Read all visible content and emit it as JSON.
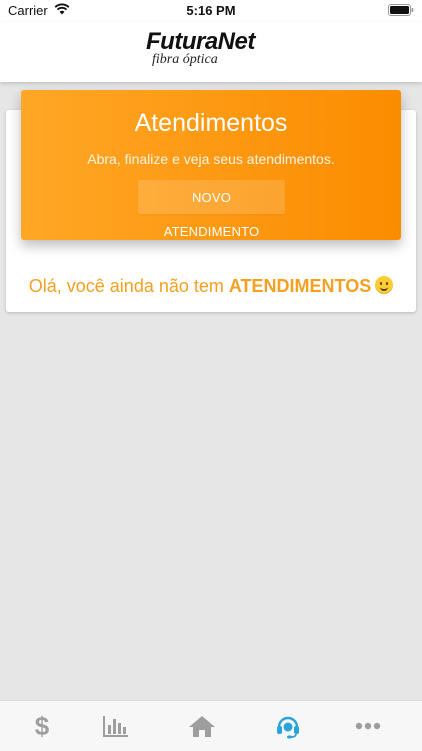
{
  "status_bar": {
    "carrier": "Carrier",
    "time": "5:16 PM"
  },
  "header": {
    "logo_main": "FuturaNet",
    "logo_sub": "fibra óptica"
  },
  "banner": {
    "title": "Atendimentos",
    "subtitle": "Abra, finalize e veja seus atendimentos.",
    "button_label": "NOVO ATENDIMENTO",
    "color_start": "#ffa726",
    "color_end": "#fb8c00"
  },
  "empty_state": {
    "text_prefix": "Olá, você ainda não tem ",
    "text_bold": "ATENDIMENTOS",
    "emoji": "slightly-smiling-face-icon",
    "color": "#f5a021"
  },
  "tab_bar": {
    "items": [
      {
        "icon": "dollar-icon",
        "active": false
      },
      {
        "icon": "bar-chart-icon",
        "active": false
      },
      {
        "icon": "home-icon",
        "active": false
      },
      {
        "icon": "headset-icon",
        "active": true
      },
      {
        "icon": "more-icon",
        "active": false
      }
    ],
    "active_color": "#2aa5dc",
    "inactive_color": "#9e9e9e"
  }
}
